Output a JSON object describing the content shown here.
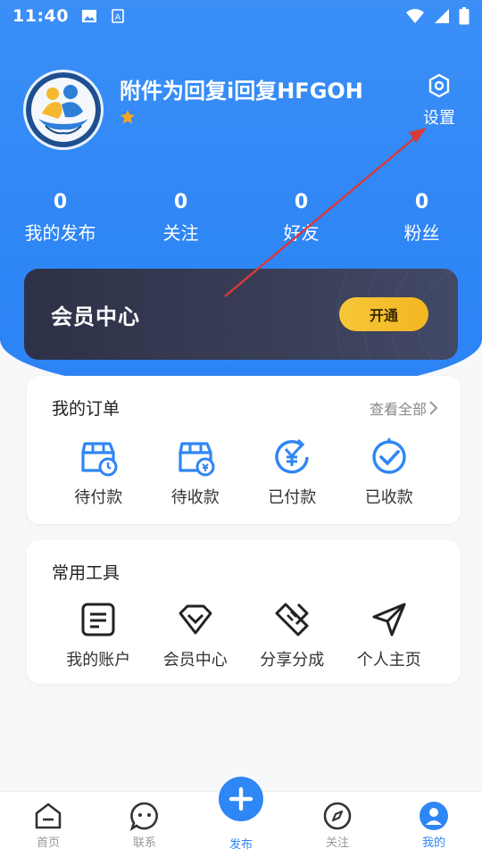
{
  "status_bar": {
    "time": "11:40"
  },
  "profile": {
    "username": "附件为回复i回复HFGOH",
    "settings_label": "设置"
  },
  "stats": [
    {
      "value": "0",
      "label": "我的发布"
    },
    {
      "value": "0",
      "label": "关注"
    },
    {
      "value": "0",
      "label": "好友"
    },
    {
      "value": "0",
      "label": "粉丝"
    }
  ],
  "vip": {
    "title": "会员中心",
    "button": "开通"
  },
  "orders": {
    "title": "我的订单",
    "view_all": "查看全部",
    "items": [
      {
        "label": "待付款",
        "icon": "box-clock-icon"
      },
      {
        "label": "待收款",
        "icon": "box-coin-icon"
      },
      {
        "label": "已付款",
        "icon": "yen-refresh-icon"
      },
      {
        "label": "已收款",
        "icon": "check-circle-icon"
      }
    ]
  },
  "tools": {
    "title": "常用工具",
    "items": [
      {
        "label": "我的账户",
        "icon": "document-icon"
      },
      {
        "label": "会员中心",
        "icon": "diamond-icon"
      },
      {
        "label": "分享分成",
        "icon": "handshake-icon"
      },
      {
        "label": "个人主页",
        "icon": "send-icon"
      }
    ]
  },
  "tabbar": {
    "items": [
      {
        "label": "首页",
        "icon": "home-icon"
      },
      {
        "label": "联系",
        "icon": "chat-icon"
      },
      {
        "label": "发布",
        "icon": "plus-icon"
      },
      {
        "label": "关注",
        "icon": "compass-icon"
      },
      {
        "label": "我的",
        "icon": "user-icon"
      }
    ],
    "active": "我的"
  },
  "colors": {
    "primary": "#2f86f5",
    "vip_dark": "#2d3147",
    "vip_gold": "#f3b721",
    "arrow": "#d93a3a"
  }
}
